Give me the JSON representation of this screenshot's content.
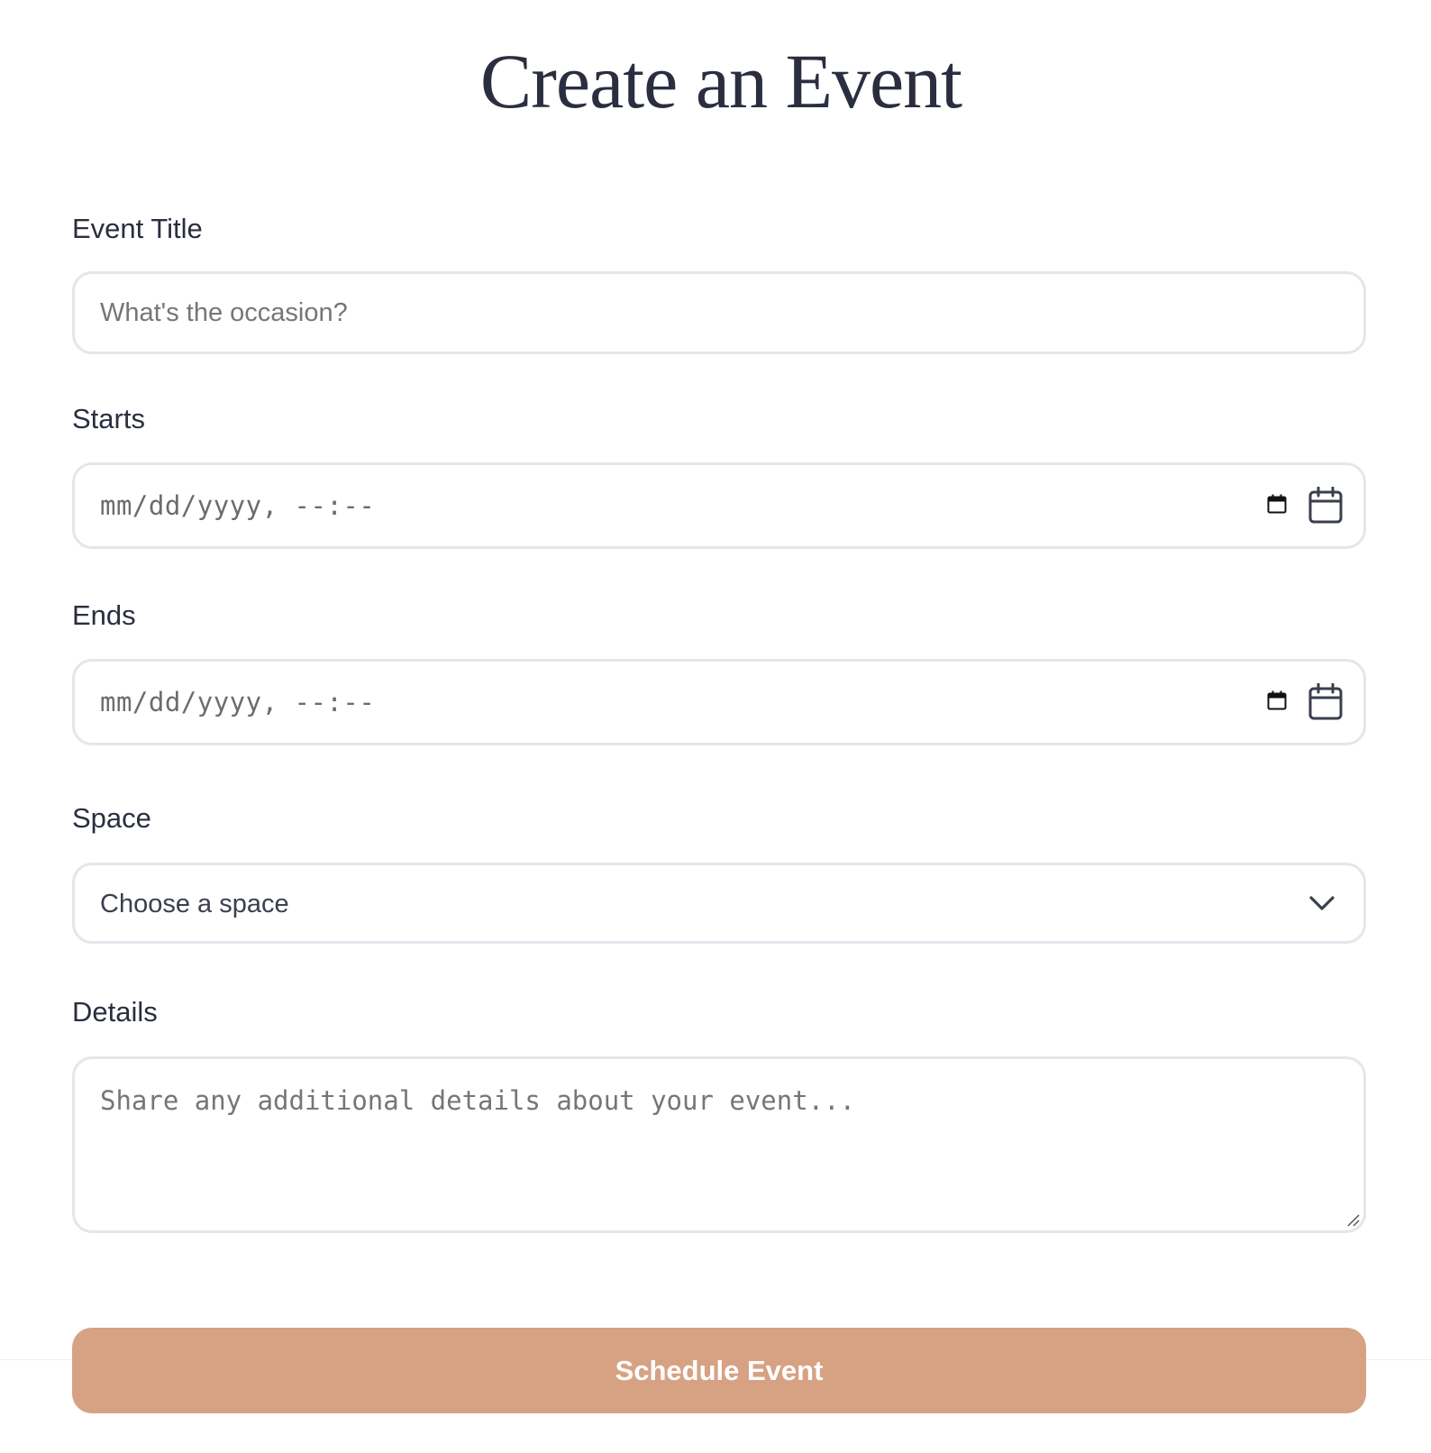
{
  "page": {
    "title": "Create an Event"
  },
  "form": {
    "event_title": {
      "label": "Event Title",
      "placeholder": "What's the occasion?"
    },
    "starts": {
      "label": "Starts",
      "placeholder": "mm/dd/yyyy, --:--",
      "icons": [
        "calendar-small-icon",
        "calendar-icon"
      ]
    },
    "ends": {
      "label": "Ends",
      "placeholder": "mm/dd/yyyy, --:--",
      "icons": [
        "calendar-small-icon",
        "calendar-icon"
      ]
    },
    "space": {
      "label": "Space",
      "selected": "Choose a space",
      "icon": "chevron-down-icon"
    },
    "details": {
      "label": "Details",
      "placeholder": "Share any additional details about your event..."
    },
    "submit": {
      "label": "Schedule Event"
    }
  },
  "colors": {
    "text": "#2a2e3f",
    "border": "#e3e6ec",
    "button_background": "#d6a283",
    "button_text": "#ffffff",
    "placeholder": "#767676"
  }
}
